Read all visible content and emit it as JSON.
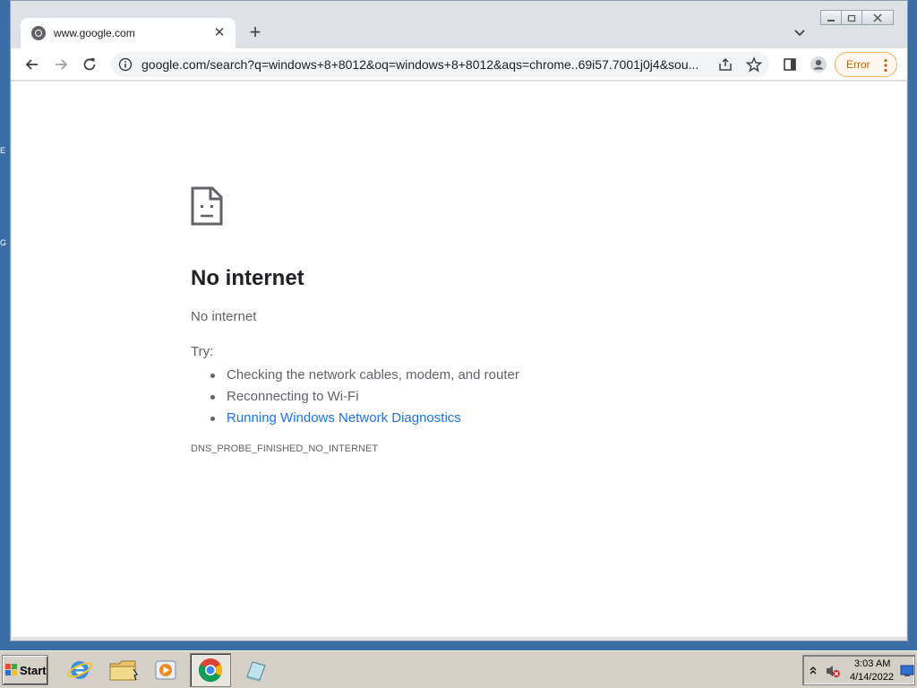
{
  "browser": {
    "tab": {
      "title": "www.google.com"
    },
    "address": {
      "url": "google.com/search?q=windows+8+8012&oq=windows+8+8012&aqs=chrome..69i57.7001j0j4&sou..."
    },
    "profile_status": "Error"
  },
  "error_page": {
    "title": "No internet",
    "subtitle": "No internet",
    "try_label": "Try:",
    "suggestions": [
      "Checking the network cables, modem, and router",
      "Reconnecting to Wi-Fi",
      "Running Windows Network Diagnostics"
    ],
    "error_code": "DNS_PROBE_FINISHED_NO_INTERNET"
  },
  "taskbar": {
    "start_label": "Start",
    "clock_time": "3:03 AM",
    "clock_date": "4/14/2022"
  },
  "desktop": {
    "fragment_a": "E",
    "fragment_b": "G"
  },
  "colors": {
    "link": "#1a73e8",
    "error_accent": "#c0620e",
    "desktop_bg": "#3a6ea5"
  }
}
